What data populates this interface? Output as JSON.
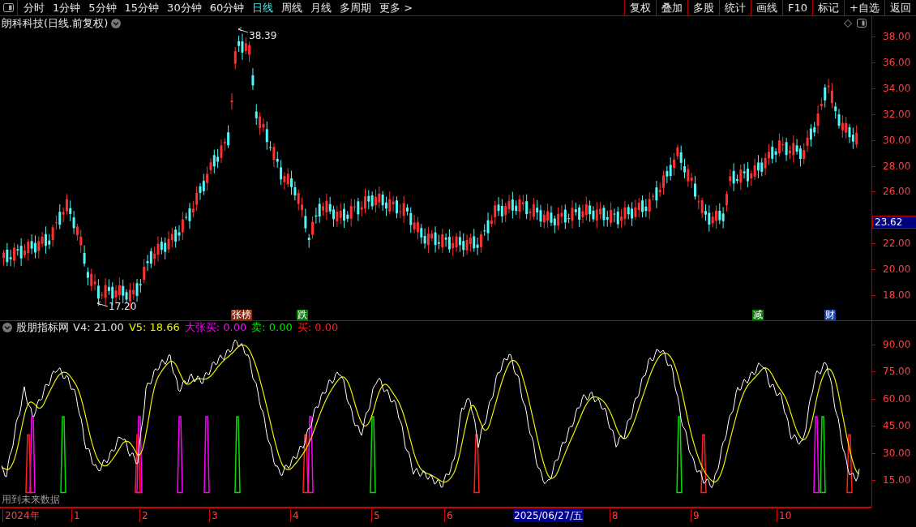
{
  "toolbar": {
    "periods": [
      {
        "label": "分时",
        "selected": false
      },
      {
        "label": "1分钟",
        "selected": false
      },
      {
        "label": "5分钟",
        "selected": false
      },
      {
        "label": "15分钟",
        "selected": false
      },
      {
        "label": "30分钟",
        "selected": false
      },
      {
        "label": "60分钟",
        "selected": false
      },
      {
        "label": "日线",
        "selected": true
      },
      {
        "label": "周线",
        "selected": false
      },
      {
        "label": "月线",
        "selected": false
      },
      {
        "label": "多周期",
        "selected": false
      },
      {
        "label": "更多 >",
        "selected": false
      }
    ],
    "buttons": [
      "复权",
      "叠加",
      "多股",
      "统计",
      "画线",
      "F10",
      "标记",
      "+自选",
      "返回"
    ]
  },
  "title": "朗科科技(日线.前复权)",
  "price_chart": {
    "high_label": "38.39",
    "low_label": "17.20",
    "current_price": "23.62",
    "axis": [
      "38.00",
      "36.00",
      "34.00",
      "32.00",
      "30.00",
      "28.00",
      "26.00",
      "22.00",
      "20.00",
      "18.00"
    ]
  },
  "event_tags": [
    {
      "label": "张榜",
      "color": "#8b2a10"
    },
    {
      "label": "跌",
      "color": "#0a7a0a"
    },
    {
      "label": "减",
      "color": "#0a7a0a"
    },
    {
      "label": "财",
      "color": "#1f3fa0"
    }
  ],
  "indicator": {
    "name": "股朋指标网",
    "readouts": [
      {
        "label": "V4:",
        "value": "21.00",
        "color": "#e0e0e0"
      },
      {
        "label": "V5:",
        "value": "18.66",
        "color": "#f0f000"
      },
      {
        "label": "大张买:",
        "value": "0.00",
        "color": "#ff00ff"
      },
      {
        "label": "卖:",
        "value": "0.00",
        "color": "#00e000"
      },
      {
        "label": "买:",
        "value": "0.00",
        "color": "#ff2020"
      }
    ],
    "axis": [
      "90.00",
      "75.00",
      "60.00",
      "45.00",
      "30.00",
      "15.00"
    ],
    "note": "用到未来数据"
  },
  "date_axis": [
    {
      "label": "2024年",
      "selected": false
    },
    {
      "label": "1",
      "selected": false
    },
    {
      "label": "2",
      "selected": false
    },
    {
      "label": "3",
      "selected": false
    },
    {
      "label": "4",
      "selected": false
    },
    {
      "label": "5",
      "selected": false
    },
    {
      "label": "6",
      "selected": false
    },
    {
      "label": "2025/06/27/五",
      "selected": true
    },
    {
      "label": "8",
      "selected": false
    },
    {
      "label": "9",
      "selected": false
    },
    {
      "label": "10",
      "selected": false
    }
  ]
}
